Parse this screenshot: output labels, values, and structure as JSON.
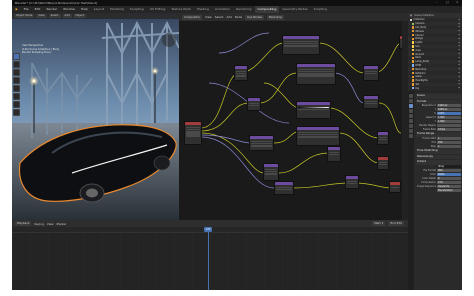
{
  "window": {
    "title": "Blender* [C:\\3D\\Work\\Blend-Node\\Auto\\Car Test\\blend]"
  },
  "menubar": {
    "menus": [
      "File",
      "Edit",
      "Render",
      "Window",
      "Help"
    ],
    "workspaces": [
      "Layout",
      "Modeling",
      "Sculpting",
      "UV Editing",
      "Texture Paint",
      "Shading",
      "Animation",
      "Rendering",
      "Compositing",
      "Geometry Nodes",
      "Scripting"
    ],
    "active_workspace": "Compositing",
    "scene": "Scene",
    "view_layer": "ViewLayer"
  },
  "viewport": {
    "header": [
      "Object Mode",
      "View",
      "Select",
      "Add",
      "Object"
    ],
    "info": [
      "User Perspective",
      "(120) Scene Collection | Body",
      "Render Sampling Done"
    ]
  },
  "node_editor": {
    "header": [
      "Compositor",
      "View",
      "Select",
      "Add",
      "Node",
      "Use Nodes",
      "Backdrop"
    ]
  },
  "outliner": {
    "header": "Scene Collection",
    "items": [
      {
        "name": "Collection",
        "color": "#e0e0e0"
      },
      {
        "name": "Camera",
        "color": "#9ccc65"
      },
      {
        "name": "Car_Body",
        "color": "#f0a030"
      },
      {
        "name": "Wheels",
        "color": "#f0a030"
      },
      {
        "name": "Interior",
        "color": "#f0a030"
      },
      {
        "name": "Bridge",
        "color": "#f0a030"
      },
      {
        "name": "Lights",
        "color": "#ffd54f"
      },
      {
        "name": "Sun",
        "color": "#ffd54f"
      },
      {
        "name": "Area",
        "color": "#ffd54f"
      },
      {
        "name": "Ground",
        "color": "#f0a030"
      },
      {
        "name": "Rails",
        "color": "#f0a030"
      },
      {
        "name": "Lamp_Posts",
        "color": "#f0a030"
      },
      {
        "name": "HDRI",
        "color": "#7cb8ff"
      },
      {
        "name": "Backdrop",
        "color": "#f0a030"
      },
      {
        "name": "Reflector",
        "color": "#f0a030"
      },
      {
        "name": "Glass",
        "color": "#f0a030"
      },
      {
        "name": "Headlights",
        "color": "#f0a030"
      },
      {
        "name": "Tail",
        "color": "#f0a030"
      },
      {
        "name": "Rig",
        "color": "#8fb3ff"
      }
    ]
  },
  "properties": {
    "section": "Scene",
    "rows": [
      {
        "section": "Format"
      },
      {
        "label": "Resolution X",
        "value": "1920 px"
      },
      {
        "label": "Y",
        "value": "1080 px"
      },
      {
        "label": "%",
        "value": "100%",
        "style": "blue"
      },
      {
        "label": "Aspect X",
        "value": "1.000"
      },
      {
        "label": "Y",
        "value": "1.000"
      },
      {
        "label": "Render Region",
        "value": ""
      },
      {
        "label": "Frame Rate",
        "value": "24 fps"
      },
      {
        "section": "Frame Range"
      },
      {
        "label": "Frame Start",
        "value": "1"
      },
      {
        "label": "End",
        "value": "250"
      },
      {
        "label": "Step",
        "value": "1"
      },
      {
        "section": "Time Stretching"
      },
      {
        "section": "Stereoscopy"
      },
      {
        "section": "Output"
      },
      {
        "label": "",
        "value": "/tmp/",
        "style": "dark"
      },
      {
        "label": "File Format",
        "value": "PNG"
      },
      {
        "label": "Color",
        "value": "RGBA",
        "style": "blue"
      },
      {
        "label": "Color Depth",
        "value": "8"
      },
      {
        "label": "Compression",
        "value": "15%"
      },
      {
        "label": "Image Sequence",
        "value": "Overwrite"
      },
      {
        "label": "",
        "value": "Placeholders"
      }
    ]
  },
  "timeline": {
    "header": [
      "Playback",
      "Keying",
      "View",
      "Marker"
    ],
    "current_frame": "120",
    "start": "Start 1",
    "end": "End 250"
  }
}
